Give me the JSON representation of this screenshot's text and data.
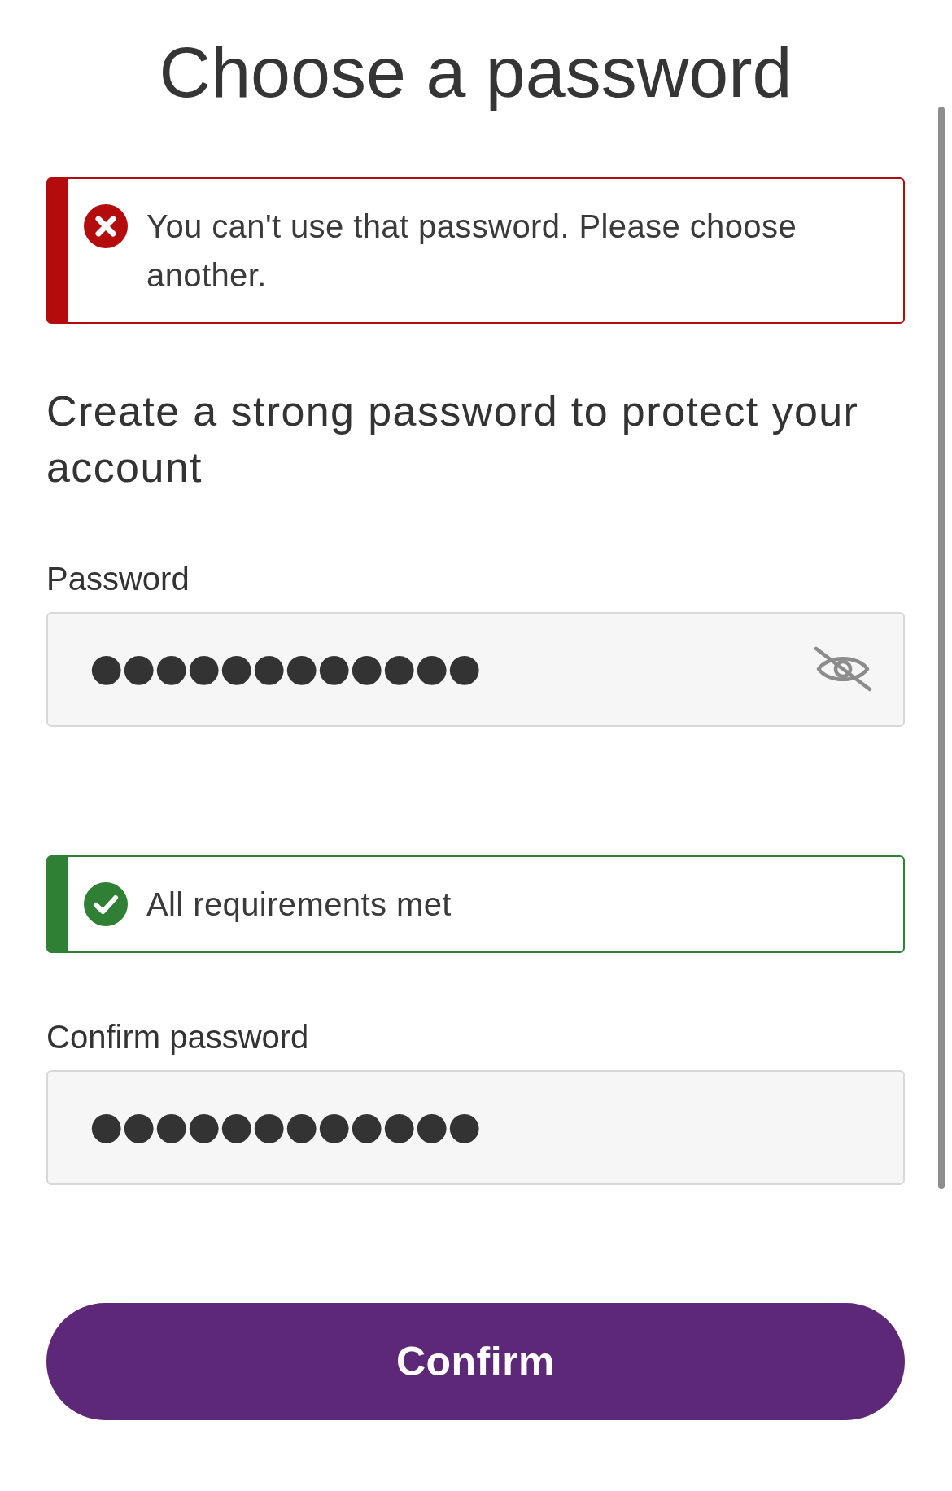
{
  "title": "Choose a password",
  "error_alert": {
    "kind": "error",
    "message": "You can't use that password. Please choose another."
  },
  "intro": "Create a strong password to protect your account",
  "password": {
    "label": "Password",
    "value": "●●●●●●●●●●●●",
    "visibility_toggle": true
  },
  "requirements_alert": {
    "kind": "success",
    "message": "All requirements met"
  },
  "confirm_password": {
    "label": "Confirm password",
    "value": "●●●●●●●●●●●●"
  },
  "confirm_button": {
    "label": "Confirm"
  }
}
